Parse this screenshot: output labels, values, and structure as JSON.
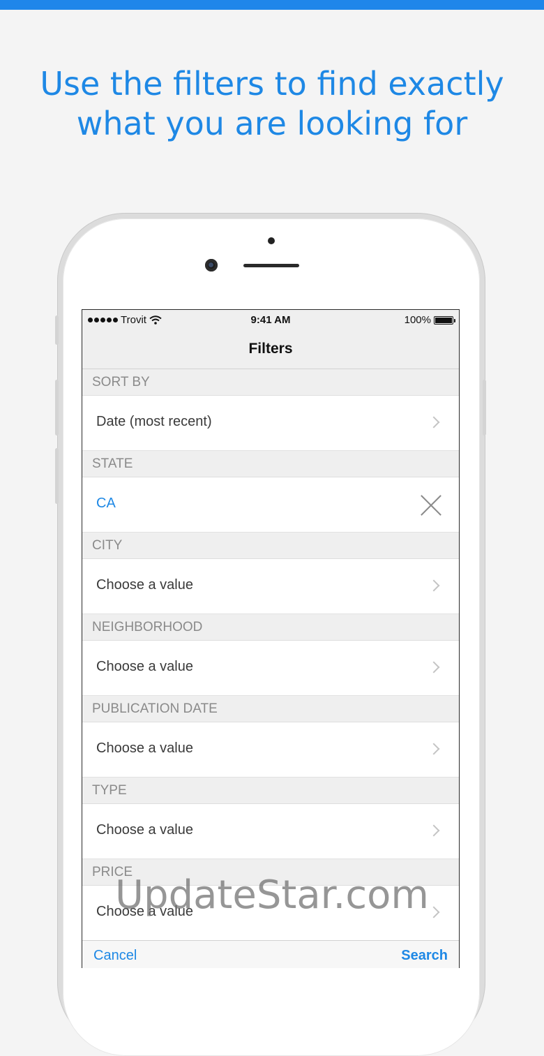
{
  "headline": {
    "line1": "Use the filters to find exactly",
    "line2": "what you are looking for"
  },
  "status_bar": {
    "carrier": "Trovit",
    "time": "9:41 AM",
    "battery": "100%"
  },
  "nav": {
    "title": "Filters"
  },
  "sections": [
    {
      "header": "SORT BY",
      "value": "Date (most recent)",
      "accessory": "chevron-right-icon"
    },
    {
      "header": "STATE",
      "value": "CA",
      "accessory": "clear-icon",
      "selected": true
    },
    {
      "header": "CITY",
      "value": "Choose a value",
      "accessory": "chevron-right-icon"
    },
    {
      "header": "NEIGHBORHOOD",
      "value": "Choose a value",
      "accessory": "chevron-right-icon"
    },
    {
      "header": "PUBLICATION DATE",
      "value": "Choose a value",
      "accessory": "chevron-right-icon"
    },
    {
      "header": "TYPE",
      "value": "Choose a value",
      "accessory": "chevron-right-icon"
    },
    {
      "header": "PRICE",
      "value": "Choose a value",
      "accessory": "chevron-right-icon"
    }
  ],
  "toolbar": {
    "cancel_label": "Cancel",
    "search_label": "Search"
  },
  "watermark": "UpdateStar.com",
  "colors": {
    "accent": "#1e88e5",
    "top_bar": "#1f86ea"
  }
}
